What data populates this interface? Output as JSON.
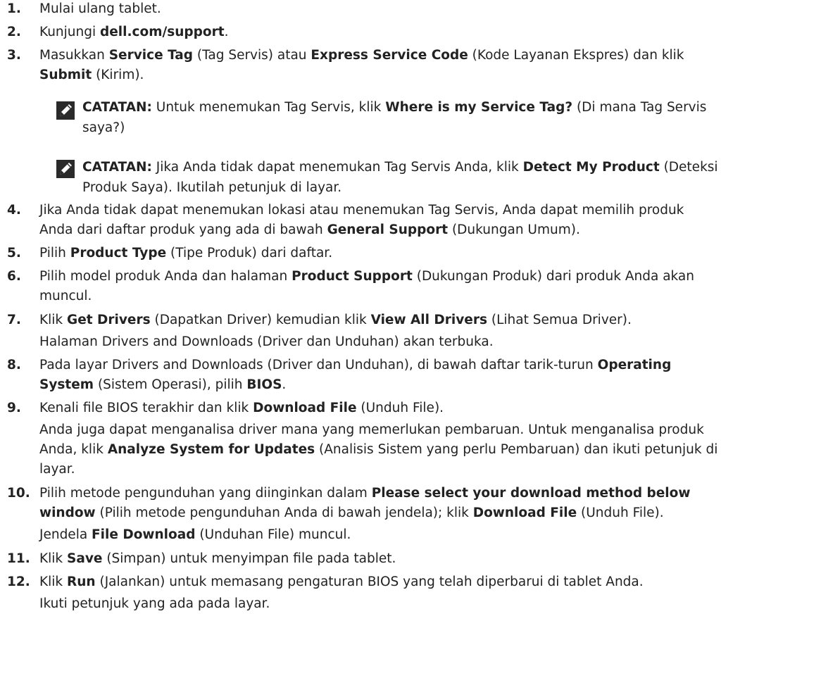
{
  "steps": [
    {
      "number": "1.",
      "text": "Mulai ulang tablet."
    },
    {
      "number": "2.",
      "prefix": "Kunjungi ",
      "bold": "dell.com/support",
      "suffix": "."
    },
    {
      "number": "3.",
      "l1_a": "Masukkan ",
      "l1_b1": "Service Tag",
      "l1_c": " (Tag Servis) atau ",
      "l1_b2": "Express Service Code",
      "l1_d": " (Kode Layanan Ekspres) dan klik",
      "l2_b": "Submit",
      "l2_c": " (Kirim)."
    },
    {
      "number": "4.",
      "l1": "Jika Anda tidak dapat menemukan lokasi atau menemukan Tag Servis, Anda dapat memilih produk",
      "l2_a": "Anda dari daftar produk yang ada di bawah ",
      "l2_b": "General Support",
      "l2_c": " (Dukungan Umum)."
    },
    {
      "number": "5.",
      "a": "Pilih ",
      "b": "Product Type",
      "c": " (Tipe Produk) dari daftar."
    },
    {
      "number": "6.",
      "l1_a": "Pilih model produk Anda dan halaman ",
      "l1_b": "Product Support",
      "l1_c": " (Dukungan Produk) dari produk Anda akan",
      "l2": "muncul."
    },
    {
      "number": "7.",
      "a": "Klik ",
      "b1": "Get Drivers",
      "c": " (Dapatkan Driver) kemudian klik ",
      "b2": "View All Drivers",
      "d": " (Lihat Semua Driver).",
      "sub": "Halaman Drivers and Downloads (Driver dan Unduhan) akan terbuka."
    },
    {
      "number": "8.",
      "l1_a": "Pada layar Drivers and Downloads (Driver dan Unduhan), di bawah daftar tarik-turun ",
      "l1_b": "Operating",
      "l2_b1": "System",
      "l2_c": " (Sistem Operasi), pilih ",
      "l2_b2": "BIOS",
      "l2_d": "."
    },
    {
      "number": "9.",
      "a": "Kenali file BIOS terakhir dan klik ",
      "b": "Download File",
      "c": " (Unduh File).",
      "sub1": "Anda juga dapat menganalisa driver mana yang memerlukan pembaruan. Untuk menganalisa produk",
      "sub2_a": "Anda, klik ",
      "sub2_b": "Analyze System for Updates",
      "sub2_c": " (Analisis Sistem yang perlu Pembaruan) dan ikuti petunjuk di",
      "sub3": "layar."
    },
    {
      "number": "10.",
      "l1_a": "Pilih metode pengunduhan yang diinginkan dalam ",
      "l1_b": "Please select your download method below",
      "l2_b1": "window",
      "l2_c": " (Pilih metode pengunduhan Anda di bawah jendela); klik ",
      "l2_b2": "Download File",
      "l2_d": " (Unduh File).",
      "sub_a": "Jendela ",
      "sub_b": "File Download",
      "sub_c": " (Unduhan File) muncul."
    },
    {
      "number": "11.",
      "a": "Klik ",
      "b": "Save",
      "c": " (Simpan) untuk menyimpan file pada tablet."
    },
    {
      "number": "12.",
      "a": "Klik ",
      "b": "Run",
      "c": " (Jalankan) untuk memasang pengaturan BIOS yang telah diperbarui di tablet Anda.",
      "sub": "Ikuti petunjuk yang ada pada layar."
    }
  ],
  "notes": [
    {
      "label": "CATATAN:",
      "l1_a": " Untuk menemukan Tag Servis, klik ",
      "l1_b": "Where is my Service Tag?",
      "l1_c": " (Di mana Tag Servis",
      "l2": "saya?)"
    },
    {
      "label": "CATATAN:",
      "l1_a": " Jika Anda tidak dapat menemukan Tag Servis Anda, klik ",
      "l1_b": "Detect My Product",
      "l1_c": " (Deteksi",
      "l2": "Produk Saya). Ikutilah petunjuk di layar."
    }
  ],
  "icons": {
    "note": "pencil-note-icon"
  },
  "colors": {
    "text": "#222222",
    "icon_bg": "#2a2a2a"
  }
}
